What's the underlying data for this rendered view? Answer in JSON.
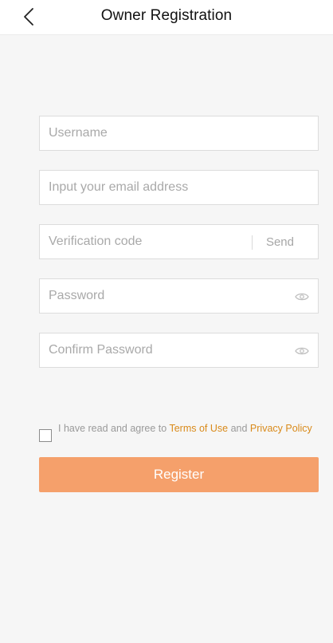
{
  "header": {
    "title": "Owner Registration"
  },
  "form": {
    "username": {
      "placeholder": "Username",
      "value": ""
    },
    "email": {
      "placeholder": "Input your email address",
      "value": ""
    },
    "verification": {
      "placeholder": "Verification code",
      "value": "",
      "send_label": "Send"
    },
    "password": {
      "placeholder": "Password",
      "value": ""
    },
    "confirm_password": {
      "placeholder": "Confirm Password",
      "value": ""
    }
  },
  "agreement": {
    "checked": false,
    "prefix": "I have read and agree to ",
    "terms_label": "Terms of Use",
    "conjunction": " and ",
    "privacy_label": "Privacy Policy"
  },
  "actions": {
    "register_label": "Register"
  },
  "icons": {
    "back": "chevron-left-icon",
    "show_password": "eye-icon"
  },
  "colors": {
    "accent": "#f5a06b",
    "link": "#d98a1a",
    "background": "#f6f6f6"
  }
}
